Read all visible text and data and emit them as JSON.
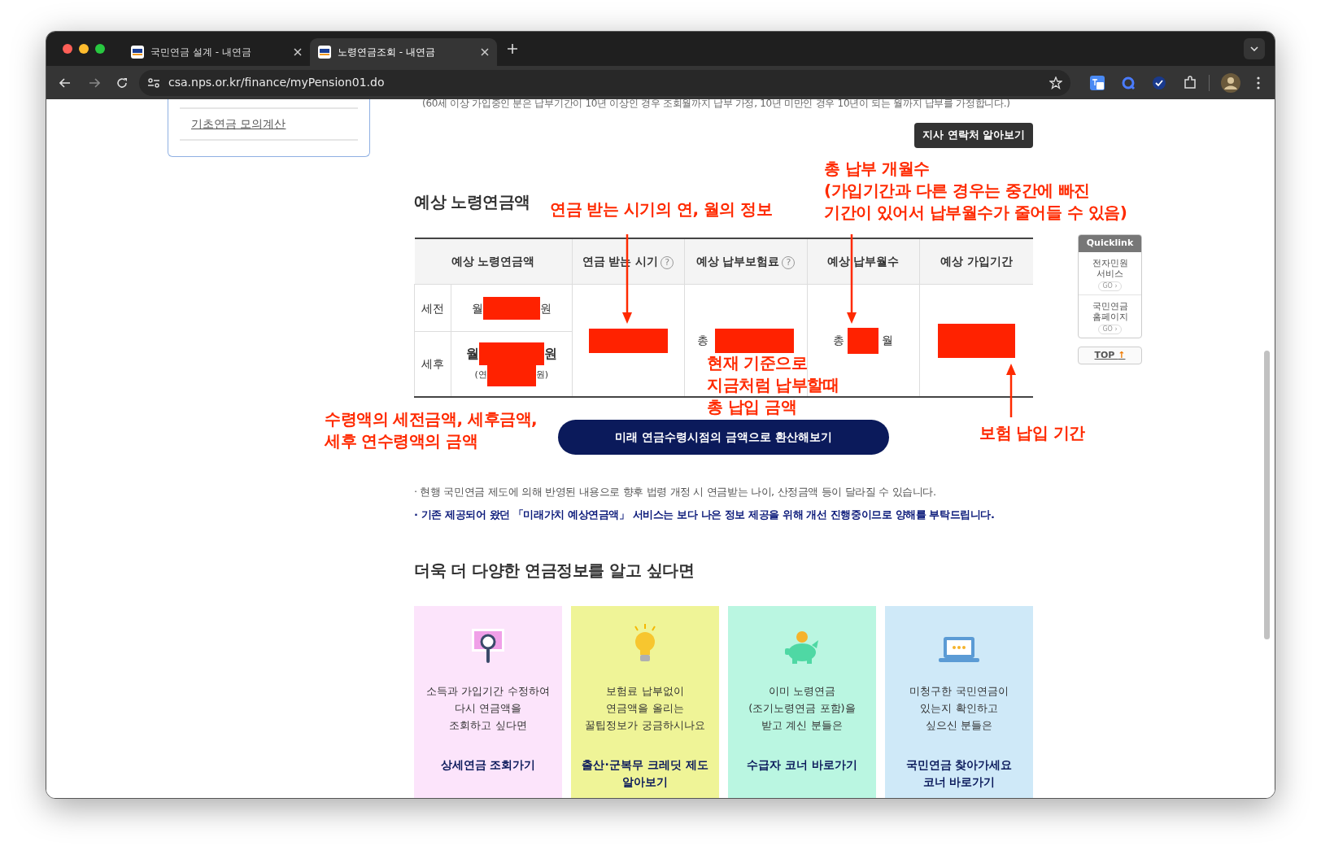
{
  "browser": {
    "tabs": [
      {
        "title": "국민연금 설계 - 내연금",
        "selected": false
      },
      {
        "title": "노령연금조회 - 내연금",
        "selected": true
      }
    ],
    "url": "csa.nps.or.kr/finance/myPension01.do"
  },
  "sidebar": {
    "items": [
      "기초연금 모의계산"
    ]
  },
  "top_note": "(60세 이상 가입중인 분은 납부기간이 10년 이상인 경우 조회월까지 납부 가정, 10년 미만인 경우 10년이 되는 월까지 납부를 가정합니다.)",
  "contact_button": "지사 연락처 알아보기",
  "section_title": "예상 노령연금액",
  "table": {
    "columns": [
      {
        "label": "예상 노령연금액"
      },
      {
        "label": "연금 받는 시기",
        "help": "?"
      },
      {
        "label": "예상 납부보험료",
        "help": "?"
      },
      {
        "label": "예상 납부월수"
      },
      {
        "label": "예상 가입기간"
      }
    ],
    "rows": [
      {
        "label": "세전",
        "prefix": "월",
        "suffix": "원",
        "redacted": true
      },
      {
        "label": "세후",
        "prefix": "월",
        "suffix": "원",
        "redacted": true,
        "annual_prefix": "(연",
        "annual_suffix": "원)"
      }
    ],
    "start_time": {
      "redacted": true
    },
    "premium": {
      "prefix": "총",
      "redacted": true
    },
    "months": {
      "prefix": "총",
      "suffix": "월",
      "redacted": true
    },
    "period": {
      "redacted": true
    }
  },
  "convert_button": "미래 연금수령시점의 금액으로 환산해보기",
  "notes": [
    {
      "text": "· 현행 국민연금 제도에 의해 반영된 내용으로 향후 법령 개정 시 연금받는 나이, 산정금액 등이 달라질 수 있습니다.",
      "emphasis": false
    },
    {
      "text": "· 기존 제공되어 왔던 「미래가치 예상연금액」 서비스는 보다 나은 정보 제공을 위해 개선 진행중이므로 양해를 부탁드립니다.",
      "emphasis": true
    }
  ],
  "more_title": "더욱 더 다양한 연금정보를 알고 싶다면",
  "cards": [
    {
      "kind": "magnifier",
      "color": "#fce4fb",
      "text": "소득과 가입기간 수정하여\n다시 연금액을\n조회하고 싶다면",
      "link": "상세연금 조회가기"
    },
    {
      "kind": "bulb",
      "color": "#eff497",
      "text": "보험료 납부없이\n연금액을 올리는\n꿀팁정보가 궁금하시나요",
      "link": "출산·군복무 크레딧 제도\n알아보기"
    },
    {
      "kind": "piggy",
      "color": "#baf6e1",
      "text": "이미 노령연금\n(조기노령연금 포함)을\n받고 계신 분들은",
      "link": "수급자 코너 바로가기"
    },
    {
      "kind": "laptop",
      "color": "#cfe9f8",
      "text": "미청구한 국민연금이\n있는지 확인하고\n싶으신 분들은",
      "link": "국민연금 찾아가세요\n코너 바로가기"
    }
  ],
  "quicklink": {
    "title": "Quicklink",
    "items": [
      {
        "label": "전자민원\n서비스",
        "go": "GO ›"
      },
      {
        "label": "국민연금\n홈페이지",
        "go": "GO ›"
      }
    ],
    "top": "TOP",
    "top_arrow": "↑"
  },
  "annotations": [
    {
      "text": "연금 받는 시기의 연, 월의 정보"
    },
    {
      "text": "총 납부 개월수\n(가입기간과 다른 경우는 중간에 빠진\n기간이 있어서 납부월수가 줄어들 수 있음)"
    },
    {
      "text": "현재 기준으로\n지금처럼 납부할때\n총 납입 금액"
    },
    {
      "text": "수령액의 세전금액, 세후금액,\n세후 연수령액의 금액"
    },
    {
      "text": "보험 납입 기간"
    }
  ],
  "arrows": [
    {
      "kind": "down"
    },
    {
      "kind": "down"
    },
    {
      "kind": "up"
    }
  ]
}
